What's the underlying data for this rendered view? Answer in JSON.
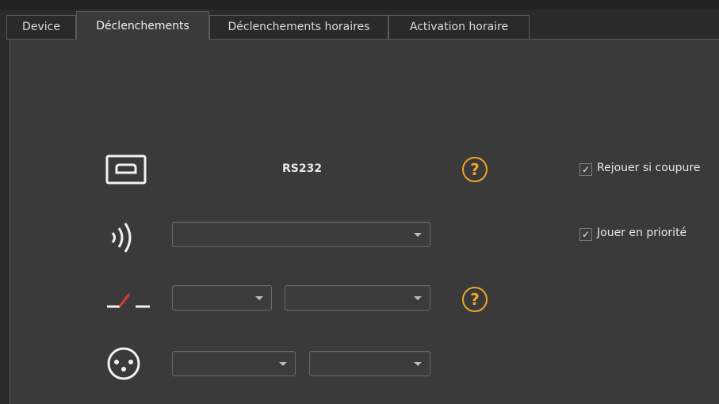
{
  "tabs": [
    {
      "label": "Device"
    },
    {
      "label": "Déclenchements"
    },
    {
      "label": "Déclenchements horaires"
    },
    {
      "label": "Activation horaire"
    }
  ],
  "active_tab": "Déclenchements",
  "rs232": {
    "label": "RS232",
    "icon": "serial-port-icon"
  },
  "rows": {
    "wireless": {
      "icon": "wireless-signal-icon",
      "select_value": ""
    },
    "contact": {
      "icon": "contact-switch-icon",
      "select1_value": "",
      "select2_value": ""
    },
    "dmx": {
      "icon": "dmx-connector-icon",
      "select1_value": "",
      "select2_value": ""
    }
  },
  "help": {
    "glyph": "?",
    "color": "#f0a52a"
  },
  "checkboxes": [
    {
      "label": "Rejouer si coupure",
      "checked": true,
      "mark": "✓"
    },
    {
      "label": "Jouer en priorité",
      "checked": true,
      "mark": "✓"
    }
  ],
  "colors": {
    "accent": "#f0a52a",
    "switch_red": "#e0392f"
  }
}
